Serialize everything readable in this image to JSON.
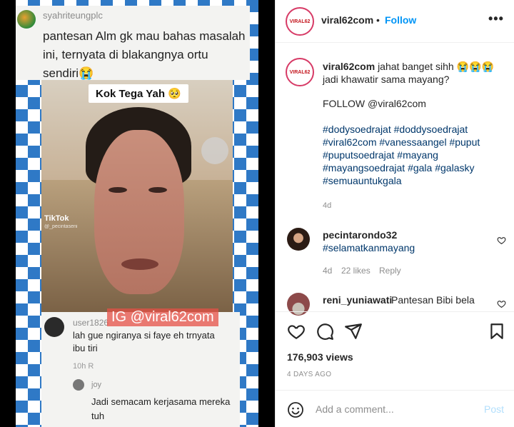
{
  "media": {
    "top_comment": {
      "username": "syahriteungplc",
      "text": "pantesan Alm gk mau bahas masalah ini, ternyata di blakangnya ortu sendiri😭"
    },
    "video_label": "Kok Tega Yah 🥺",
    "tiktok": {
      "brand": "TikTok",
      "handle": "@_pecintaseni"
    },
    "watermark": "IG @viral62com",
    "bottom_comment": {
      "username": "user1826",
      "text": "lah gue ngiranya si faye eh trnyata ibu tiri",
      "time": "10h  R"
    },
    "reply": {
      "username": "joy",
      "text": "Jadi semacam kerjasama mereka tuh"
    }
  },
  "header": {
    "logo_text": "VIRAL62",
    "username": "viral62com",
    "dot": "•",
    "follow_label": "Follow",
    "more_label": "•••"
  },
  "caption": {
    "username": "viral62com",
    "text": "jahat banget sihh 😭😭😭 jadi khawatir sama mayang?",
    "follow_line": "FOLLOW @viral62com",
    "hashtags": "#dodysoedrajat #doddysoedrajat #viral62com #vanessaangel #puput #puputsoedrajat #mayang #mayangsoedrajat #gala #galasky #semuauntukgala",
    "age": "4d"
  },
  "comments": [
    {
      "username": "pecintarondo32",
      "text": "#selamatkanmayang",
      "age": "4d",
      "likes": "22 likes",
      "reply_label": "Reply"
    },
    {
      "username": "reni_yuniawati",
      "text": "Pantesan Bibi bela"
    }
  ],
  "stats": {
    "views": "176,903 views",
    "posted": "4 DAYS AGO"
  },
  "add_comment": {
    "placeholder": "Add a comment...",
    "post_label": "Post"
  },
  "colors": {
    "accent": "#0095f6",
    "post_disabled": "#b2dffc",
    "hashtag": "#00376b",
    "pattern_blue": "#2f79c6"
  }
}
